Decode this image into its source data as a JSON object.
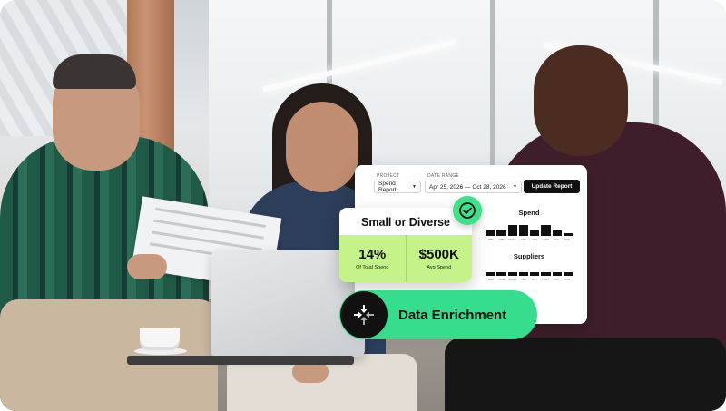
{
  "report": {
    "project_label": "PROJECT",
    "project_value": "Spend Report",
    "date_label": "DATE RANGE",
    "date_value": "Apr 25, 2026 — Oct 28, 2026",
    "update_button": "Update Report",
    "spend": {
      "title": "Spend",
      "bars": [
        0.3,
        0.3,
        0.6,
        0.6,
        0.3,
        0.6,
        0.3,
        0.15
      ],
      "ticks": [
        "MBE",
        "WBE",
        "SMALL",
        "VBE",
        "HPT",
        "LGBT",
        "DIS",
        "HUB"
      ]
    },
    "suppliers": {
      "title": "Suppliers",
      "bars": [
        0.2,
        0.2,
        0.2,
        0.2,
        0.2,
        0.2,
        0.2,
        0.2
      ],
      "ticks": [
        "MBE",
        "WBE",
        "SMALL",
        "VBE",
        "HPT",
        "LGBT",
        "DIS",
        "HUB"
      ]
    }
  },
  "diverse": {
    "title": "Small or Diverse",
    "stats": [
      {
        "value": "14%",
        "label": "Of Total Spend"
      },
      {
        "value": "$500K",
        "label": "Avg Spend"
      }
    ]
  },
  "enrichment": {
    "label": "Data Enrichment"
  },
  "colors": {
    "accent_lime": "#c6f28a",
    "accent_green": "#36dd8c",
    "badge_green": "#3ee08a",
    "dark": "#111111"
  },
  "icons": {
    "check": "check-circle-icon",
    "enrich": "arrows-converge-icon",
    "caret": "chevron-down-icon"
  }
}
